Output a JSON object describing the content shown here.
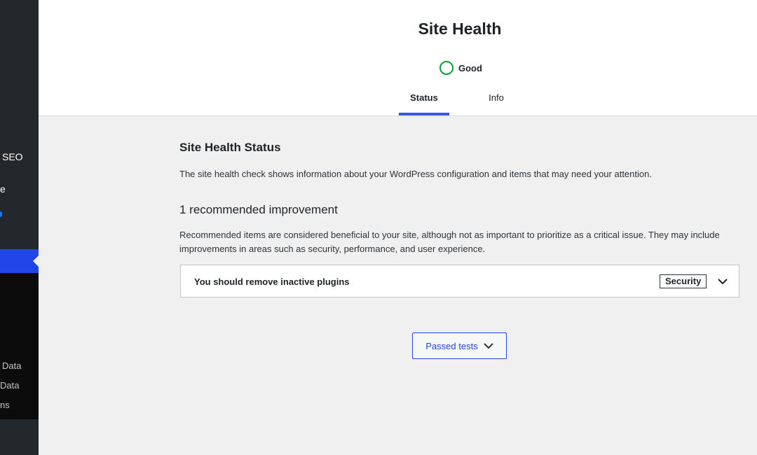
{
  "sidebar": {
    "items": [
      "SEO",
      "e"
    ],
    "subitems": [
      "Data",
      "Data",
      "ns"
    ]
  },
  "header": {
    "title": "Site Health",
    "status_label": "Good",
    "tabs": [
      {
        "label": "Status",
        "active": true
      },
      {
        "label": "Info",
        "active": false
      }
    ]
  },
  "main": {
    "heading": "Site Health Status",
    "description": "The site health check shows information about your WordPress configuration and items that may need your attention.",
    "recommended_heading": "1 recommended improvement",
    "recommended_description": "Recommended items are considered beneficial to your site, although not as important to prioritize as a critical issue. They may include improvements in areas such as security, performance, and user experience.",
    "issues": [
      {
        "title": "You should remove inactive plugins",
        "badge": "Security"
      }
    ],
    "passed_tests_label": "Passed tests"
  },
  "colors": {
    "accent": "#3858e9",
    "good_status": "#00a32a",
    "sidebar_bg": "#23282d",
    "sidebar_current": "#2145e6"
  },
  "icons": [
    "chevron-down-icon",
    "status-circle-icon"
  ]
}
